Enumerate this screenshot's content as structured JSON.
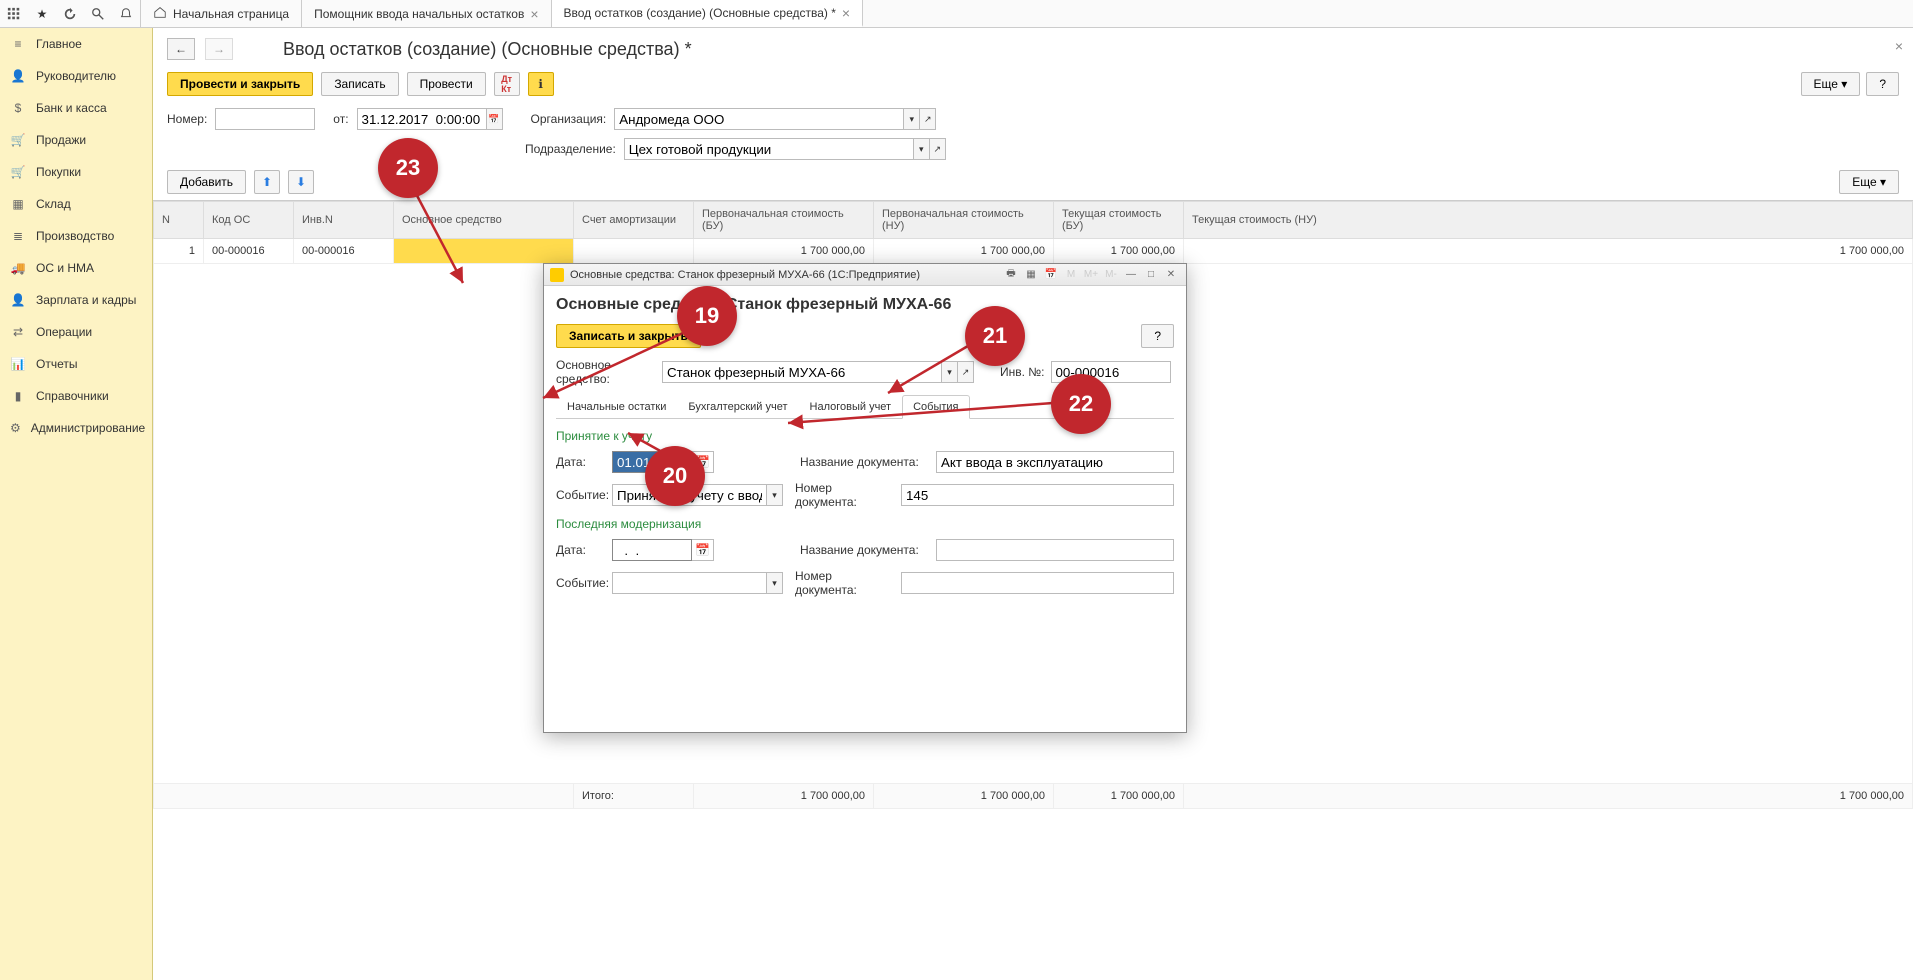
{
  "toolbar": {
    "tabs": [
      {
        "label": "Начальная страница",
        "closable": false,
        "active": false
      },
      {
        "label": "Помощник ввода начальных остатков",
        "closable": true,
        "active": false
      },
      {
        "label": "Ввод остатков (создание) (Основные средства) *",
        "closable": true,
        "active": true
      }
    ]
  },
  "sidebar": {
    "items": [
      {
        "label": "Главное",
        "icon": "menu"
      },
      {
        "label": "Руководителю",
        "icon": "person"
      },
      {
        "label": "Банк и касса",
        "icon": "dollar"
      },
      {
        "label": "Продажи",
        "icon": "cart"
      },
      {
        "label": "Покупки",
        "icon": "cart"
      },
      {
        "label": "Склад",
        "icon": "box"
      },
      {
        "label": "Производство",
        "icon": "list"
      },
      {
        "label": "ОС и НМА",
        "icon": "truck"
      },
      {
        "label": "Зарплата и кадры",
        "icon": "person"
      },
      {
        "label": "Операции",
        "icon": "flow"
      },
      {
        "label": "Отчеты",
        "icon": "chart"
      },
      {
        "label": "Справочники",
        "icon": "book"
      },
      {
        "label": "Администрирование",
        "icon": "gear"
      }
    ]
  },
  "doc": {
    "title": "Ввод остатков (создание) (Основные средства) *",
    "buttons": {
      "post_close": "Провести и закрыть",
      "write": "Записать",
      "post": "Провести",
      "more": "Еще",
      "help": "?"
    },
    "number_label": "Номер:",
    "number_value": "",
    "from_label": "от:",
    "date_value": "31.12.2017  0:00:00",
    "org_label": "Организация:",
    "org_value": "Андромеда ООО",
    "dept_label": "Подразделение:",
    "dept_value": "Цех готовой продукции",
    "add_button": "Добавить",
    "more_short": "Еще"
  },
  "table": {
    "headers": [
      "N",
      "Код ОС",
      "Инв.N",
      "Основное средство",
      "Счет амортизации",
      "Первоначальная стоимость (БУ)",
      "Первоначальная стоимость (НУ)",
      "Текущая стоимость (БУ)",
      "Текущая стоимость (НУ)"
    ],
    "rows": [
      {
        "n": "1",
        "code": "00-000016",
        "inv": "00-000016",
        "name": "",
        "acct": "",
        "cost_bu": "1 700 000,00",
        "cost_nu": "1 700 000,00",
        "cur_bu": "1 700 000,00",
        "cur_nu": "1 700 000,00"
      }
    ],
    "footer_label": "Итого:",
    "footer": [
      "1 700 000,00",
      "1 700 000,00",
      "1 700 000,00",
      "1 700 000,00"
    ]
  },
  "modal": {
    "window_title": "Основные средства: Станок фрезерный МУХА-66  (1С:Предприятие)",
    "title": "Основные средства: Станок фрезерный МУХА-66",
    "write_close": "Записать и закрыть",
    "help": "?",
    "os_label": "Основное средство:",
    "os_value": "Станок фрезерный МУХА-66",
    "inv_label": "Инв. №:",
    "inv_value": "00-000016",
    "tabs": [
      "Начальные остатки",
      "Бухгалтерский учет",
      "Налоговый учет",
      "События"
    ],
    "active_tab": 3,
    "section1": "Принятие к учету",
    "date_label": "Дата:",
    "date_value": "01.01.2013",
    "event_label": "Событие:",
    "event_value": "Принятие к учету с вводом в эк",
    "docname_label": "Название документа:",
    "docname_value": "Акт ввода в эксплуатацию",
    "docnum_label": "Номер документа:",
    "docnum_value": "145",
    "section2": "Последняя модернизация",
    "mod_date_value": "  .  .",
    "mod_event_value": "",
    "mod_docname_value": "",
    "mod_docnum_value": ""
  },
  "annotations": {
    "n19": "19",
    "n20": "20",
    "n21": "21",
    "n22": "22",
    "n23": "23"
  }
}
